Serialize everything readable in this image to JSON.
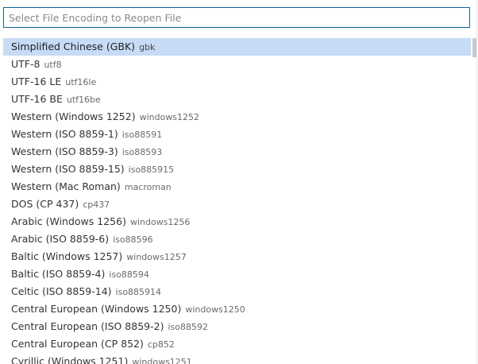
{
  "search": {
    "placeholder": "Select File Encoding to Reopen File",
    "value": ""
  },
  "colors": {
    "selected_bg": "#c6dcf6",
    "focus_border": "#0e639c"
  },
  "encodings": [
    {
      "label": "Simplified Chinese (GBK)",
      "id": "gbk",
      "selected": true
    },
    {
      "label": "UTF-8",
      "id": "utf8"
    },
    {
      "label": "UTF-16 LE",
      "id": "utf16le"
    },
    {
      "label": "UTF-16 BE",
      "id": "utf16be"
    },
    {
      "label": "Western (Windows 1252)",
      "id": "windows1252"
    },
    {
      "label": "Western (ISO 8859-1)",
      "id": "iso88591"
    },
    {
      "label": "Western (ISO 8859-3)",
      "id": "iso88593"
    },
    {
      "label": "Western (ISO 8859-15)",
      "id": "iso885915"
    },
    {
      "label": "Western (Mac Roman)",
      "id": "macroman"
    },
    {
      "label": "DOS (CP 437)",
      "id": "cp437"
    },
    {
      "label": "Arabic (Windows 1256)",
      "id": "windows1256"
    },
    {
      "label": "Arabic (ISO 8859-6)",
      "id": "iso88596"
    },
    {
      "label": "Baltic (Windows 1257)",
      "id": "windows1257"
    },
    {
      "label": "Baltic (ISO 8859-4)",
      "id": "iso88594"
    },
    {
      "label": "Celtic (ISO 8859-14)",
      "id": "iso885914"
    },
    {
      "label": "Central European (Windows 1250)",
      "id": "windows1250"
    },
    {
      "label": "Central European (ISO 8859-2)",
      "id": "iso88592"
    },
    {
      "label": "Central European (CP 852)",
      "id": "cp852"
    },
    {
      "label": "Cyrillic (Windows 1251)",
      "id": "windows1251"
    }
  ]
}
